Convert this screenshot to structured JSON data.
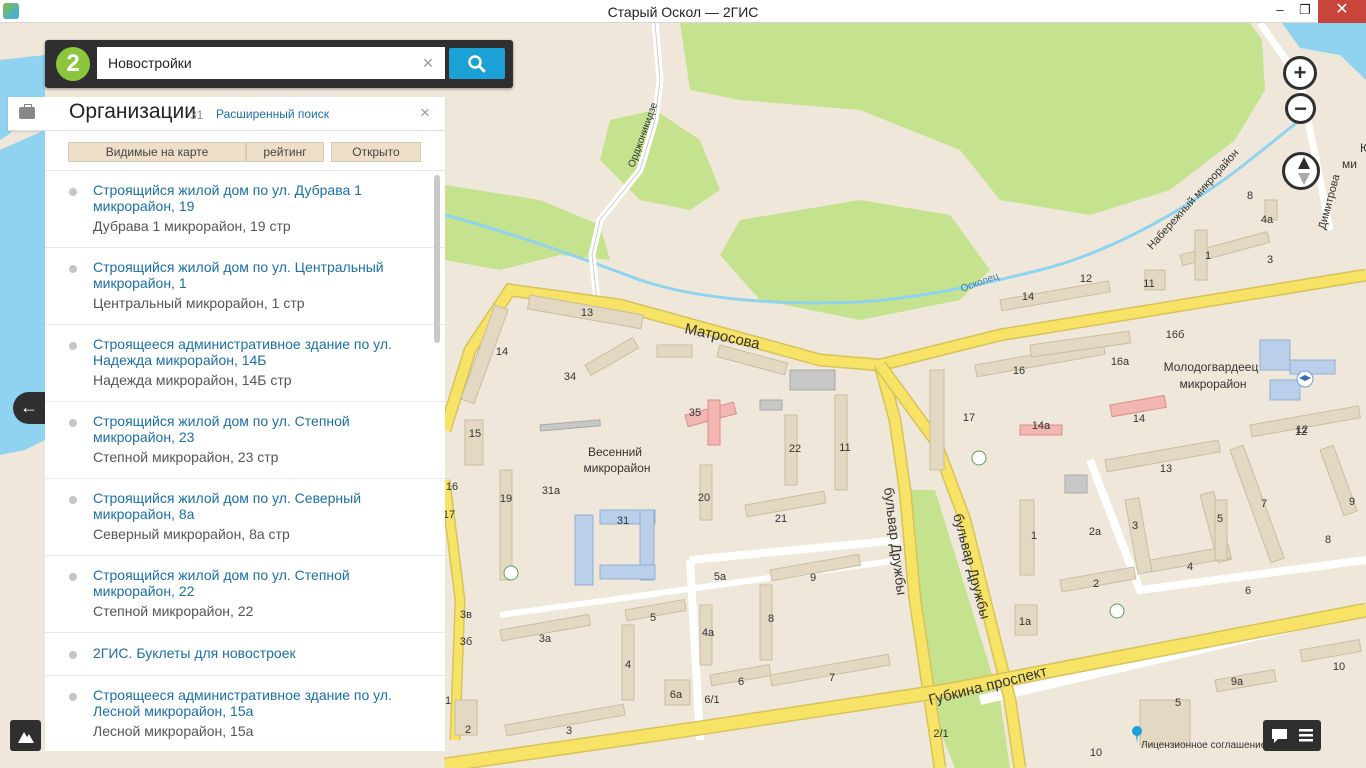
{
  "window": {
    "title": "Старый Оскол — 2ГИС",
    "minimize_label": "–",
    "maximize_label": "❐",
    "close_label": "✕"
  },
  "search": {
    "logo_text": "2",
    "value": "Новостройки",
    "clear_label": "×"
  },
  "results": {
    "title": "Организации",
    "count": "31",
    "advanced_link": "Расширенный поиск",
    "close_label": "×",
    "filters": [
      "Видимые на карте",
      "рейтинг",
      "Открыто"
    ],
    "items": [
      {
        "name": "Строящийся жилой дом по ул. Дубрава 1 микрорайон, 19",
        "address": "Дубрава 1 микрорайон, 19 стр"
      },
      {
        "name": "Строящийся жилой дом по ул. Центральный микрорайон, 1",
        "address": "Центральный микрорайон, 1 стр"
      },
      {
        "name": "Строящееся административное здание по ул. Надежда микрорайон, 14Б",
        "address": "Надежда микрорайон, 14Б стр"
      },
      {
        "name": "Строящийся жилой дом по ул. Степной микрорайон, 23",
        "address": "Степной микрорайон, 23 стр"
      },
      {
        "name": "Строящийся жилой дом по ул. Северный микрорайон, 8а",
        "address": "Северный микрорайон, 8а стр"
      },
      {
        "name": "Строящийся жилой дом по ул. Степной микрорайон, 22",
        "address": "Степной микрорайон, 22"
      },
      {
        "name": "2ГИС. Буклеты для новостроек",
        "address": ""
      },
      {
        "name": "Строящееся административное здание по ул. Лесной микрорайон, 15а",
        "address": "Лесной микрорайон, 15а"
      }
    ]
  },
  "map": {
    "streets": [
      "Орджоникидзе",
      "Матросова",
      "Набережный микрорайон",
      "Димитрова",
      "Осколец",
      "бульвар Дружбы",
      "бульвар Дружбы",
      "Губкина проспект"
    ],
    "districts": [
      "Весенний микрорайон",
      "Молодогвардеец микрорайон"
    ],
    "district_lines": [
      [
        "Весенний",
        "микрорайон"
      ],
      [
        "Молодогвардеец",
        "микрорайон"
      ]
    ],
    "corner_labels": [
      "Ю",
      "ми"
    ],
    "house_numbers": [
      "13",
      "14",
      "34",
      "35",
      "15",
      "16",
      "17",
      "19",
      "31а",
      "31",
      "22",
      "11",
      "20",
      "21",
      "17",
      "14а",
      "14",
      "16",
      "16а",
      "16б",
      "12",
      "13",
      "1",
      "2а",
      "3",
      "5",
      "7",
      "9",
      "8",
      "4",
      "6",
      "2",
      "1а",
      "12",
      "14",
      "11",
      "8",
      "4а",
      "1",
      "3",
      "5а",
      "9",
      "4а",
      "8",
      "5",
      "4",
      "3в",
      "3б",
      "3а",
      "6а",
      "6/1",
      "6",
      "7",
      "2/1",
      "1",
      "2",
      "3",
      "10",
      "9а",
      "5",
      "10",
      "12"
    ],
    "license": "Лицензионное соглашение"
  },
  "controls": {
    "zoom_in": "+",
    "zoom_out": "−",
    "back": "←"
  },
  "colors": {
    "accent": "#1ba1d6",
    "logo": "#8cc63f",
    "link": "#1a6fa8",
    "road": "#f7e467",
    "park": "#c5e28e",
    "water": "#8fd3f0"
  },
  "icons": [
    "briefcase-icon",
    "search-icon",
    "back-arrow-icon",
    "layers-icon",
    "chat-icon",
    "menu-icon",
    "compass-icon",
    "map-pin-icon",
    "school-icon",
    "pharmacy-icon"
  ]
}
